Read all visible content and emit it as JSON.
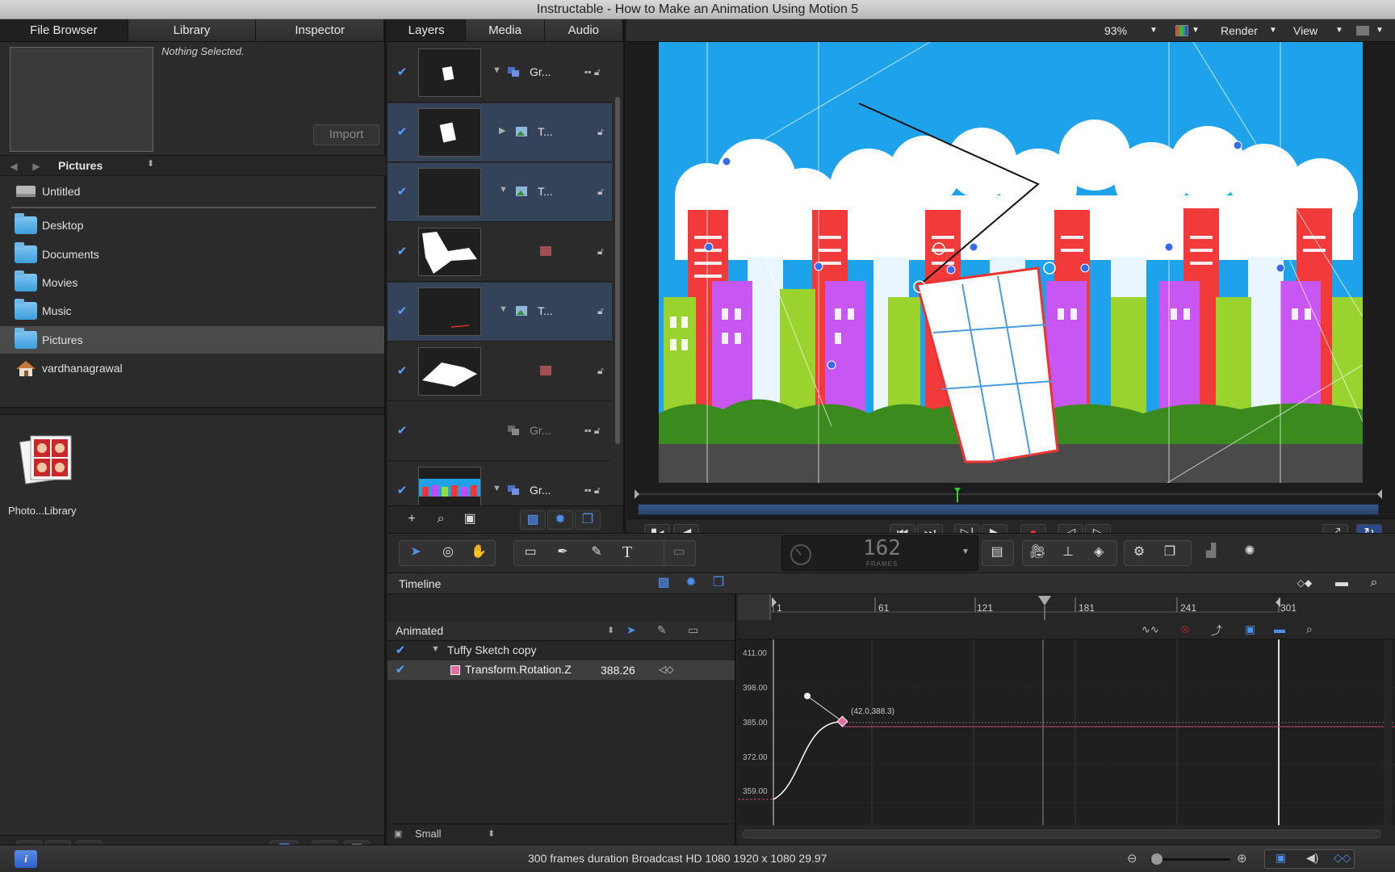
{
  "window": {
    "title": "Instructable - How to Make an Animation Using Motion 5"
  },
  "left_panel": {
    "tabs": [
      "File Browser",
      "Library",
      "Inspector"
    ],
    "preview_text": "Nothing Selected.",
    "import_label": "Import",
    "path_label": "Pictures",
    "volumes": [
      "Untitled"
    ],
    "places": [
      "Desktop",
      "Documents",
      "Movies",
      "Music",
      "Pictures",
      "vardhanagrawal"
    ],
    "selected_place": "Pictures",
    "file_items": [
      "Photo...Library"
    ]
  },
  "layers_panel": {
    "tabs": [
      "Layers",
      "Media",
      "Audio"
    ],
    "rows": [
      {
        "name": "Gr...",
        "expanded": true,
        "type": "group",
        "selected": false
      },
      {
        "name": "T...",
        "expanded": false,
        "type": "image",
        "selected": true
      },
      {
        "name": "T...",
        "expanded": true,
        "type": "image",
        "selected": true
      },
      {
        "name": "",
        "expanded": false,
        "type": "mask",
        "selected": false
      },
      {
        "name": "T...",
        "expanded": true,
        "type": "image",
        "selected": true
      },
      {
        "name": "",
        "expanded": false,
        "type": "mask",
        "selected": false
      },
      {
        "name": "Gr...",
        "expanded": false,
        "type": "group",
        "selected": false,
        "dim": true
      },
      {
        "name": "Gr...",
        "expanded": true,
        "type": "group",
        "selected": false
      }
    ]
  },
  "canvas": {
    "zoom": "93%",
    "render_label": "Render",
    "view_label": "View"
  },
  "frame_display": {
    "value": "162",
    "unit": "FRAMES"
  },
  "timeline": {
    "title": "Timeline",
    "filter_label": "Animated",
    "ruler_ticks": [
      "1",
      "61",
      "121",
      "181",
      "241",
      "301"
    ],
    "tracks": [
      {
        "name": "Tuffy Sketch copy",
        "value": ""
      },
      {
        "name": "Transform.Rotation.Z",
        "value": "388.26"
      }
    ],
    "y_ticks": [
      "411.00",
      "398.00",
      "385.00",
      "372.00",
      "359.00"
    ],
    "keyframe_label": "(42.0,388.3)",
    "size_label": "Small"
  },
  "status": {
    "text": "300 frames duration Broadcast HD 1080 1920 x 1080 29.97"
  },
  "colors": {
    "accent": "#4f8ff0",
    "selection": "#34425a",
    "sky": "#1ea3ea"
  }
}
